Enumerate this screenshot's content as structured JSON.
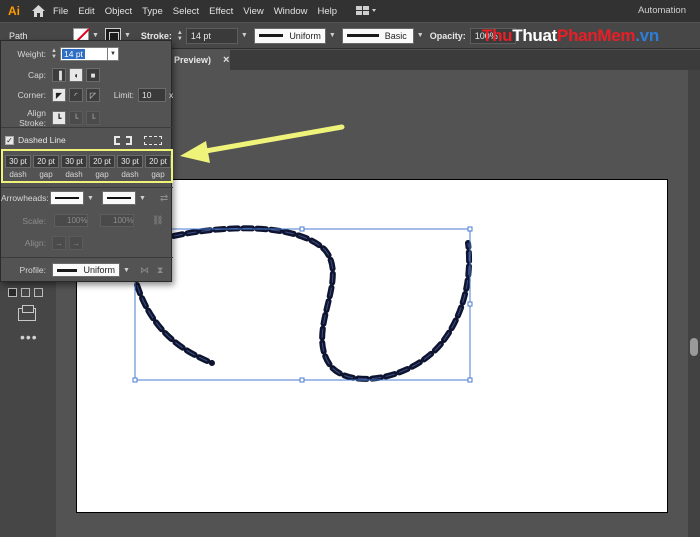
{
  "app": {
    "logo": "Ai"
  },
  "menu": [
    "File",
    "Edit",
    "Object",
    "Type",
    "Select",
    "Effect",
    "View",
    "Window",
    "Help"
  ],
  "workspace": "Automation",
  "control_bar": {
    "selection_label": "Path",
    "stroke_label": "Stroke:",
    "stroke_weight": "14 pt",
    "variable_width_profile": "Uniform",
    "brush": "Basic",
    "opacity_label": "Opacity:",
    "opacity_value": "100%"
  },
  "watermark": {
    "part1": "Thu",
    "part2": "Thuat",
    "part3": "PhanMem",
    "part4": ".vn"
  },
  "document_tab": {
    "title": "Preview)"
  },
  "stroke_panel": {
    "weight_label": "Weight:",
    "weight_value": "14 pt",
    "cap_label": "Cap:",
    "corner_label": "Corner:",
    "limit_label": "Limit:",
    "limit_value": "10",
    "limit_unit": "x",
    "align_stroke_label": "Align Stroke:",
    "dashed_line_label": "Dashed Line",
    "dashed_line_checked": true,
    "dash_fields": [
      {
        "value": "30 pt",
        "caption": "dash"
      },
      {
        "value": "20 pt",
        "caption": "gap"
      },
      {
        "value": "30 pt",
        "caption": "dash"
      },
      {
        "value": "20 pt",
        "caption": "gap"
      },
      {
        "value": "30 pt",
        "caption": "dash"
      },
      {
        "value": "20 pt",
        "caption": "gap"
      }
    ],
    "arrowheads_label": "Arrowheads:",
    "scale_label": "Scale:",
    "scale_start": "100%",
    "scale_end": "100%",
    "align_label": "Align:",
    "profile_label": "Profile:",
    "profile_value": "Uniform"
  },
  "colors": {
    "highlight": "#f0f37a",
    "path_stroke": "#0f1530",
    "selection": "#4a7bd0",
    "watermark_red": "#e91e26",
    "watermark_blue": "#2d7dd9"
  }
}
